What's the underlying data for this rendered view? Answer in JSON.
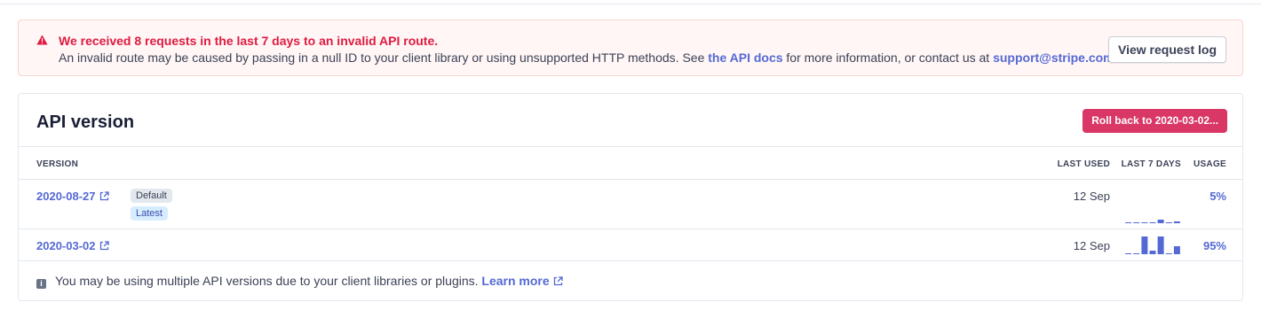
{
  "alert": {
    "title": "We received 8 requests in the last 7 days to an invalid API route.",
    "body_prefix": "An invalid route may be caused by passing in a null ID to your client library or using unsupported HTTP methods. See ",
    "docs_link": "the API docs",
    "body_middle": " for more information, or contact us at ",
    "email_link": "support@stripe.com",
    "body_suffix": ".",
    "button_label": "View request log",
    "icon": "warning-triangle-icon"
  },
  "api_version": {
    "title": "API version",
    "rollback_button": "Roll back to 2020-03-02...",
    "columns": {
      "version": "VERSION",
      "last_used": "LAST USED",
      "last_7_days": "LAST 7 DAYS",
      "usage": "USAGE"
    },
    "rows": [
      {
        "version": "2020-08-27",
        "badges": [
          "Default",
          "Latest"
        ],
        "last_used": "12 Sep",
        "usage": "5%",
        "last_7_days_relative": [
          0,
          0,
          0,
          0,
          0.2,
          0,
          0.1
        ]
      },
      {
        "version": "2020-03-02",
        "badges": [],
        "last_used": "12 Sep",
        "usage": "95%",
        "last_7_days_relative": [
          0,
          0,
          1.0,
          0.2,
          1.0,
          0,
          0.45
        ]
      }
    ],
    "footnote": {
      "text": "You may be using multiple API versions due to your client libraries or plugins. ",
      "link": "Learn more"
    }
  },
  "colors": {
    "accent": "#5469d4",
    "danger": "#df1b41",
    "rollback": "#d93765",
    "sparkline": "#5469d4"
  }
}
